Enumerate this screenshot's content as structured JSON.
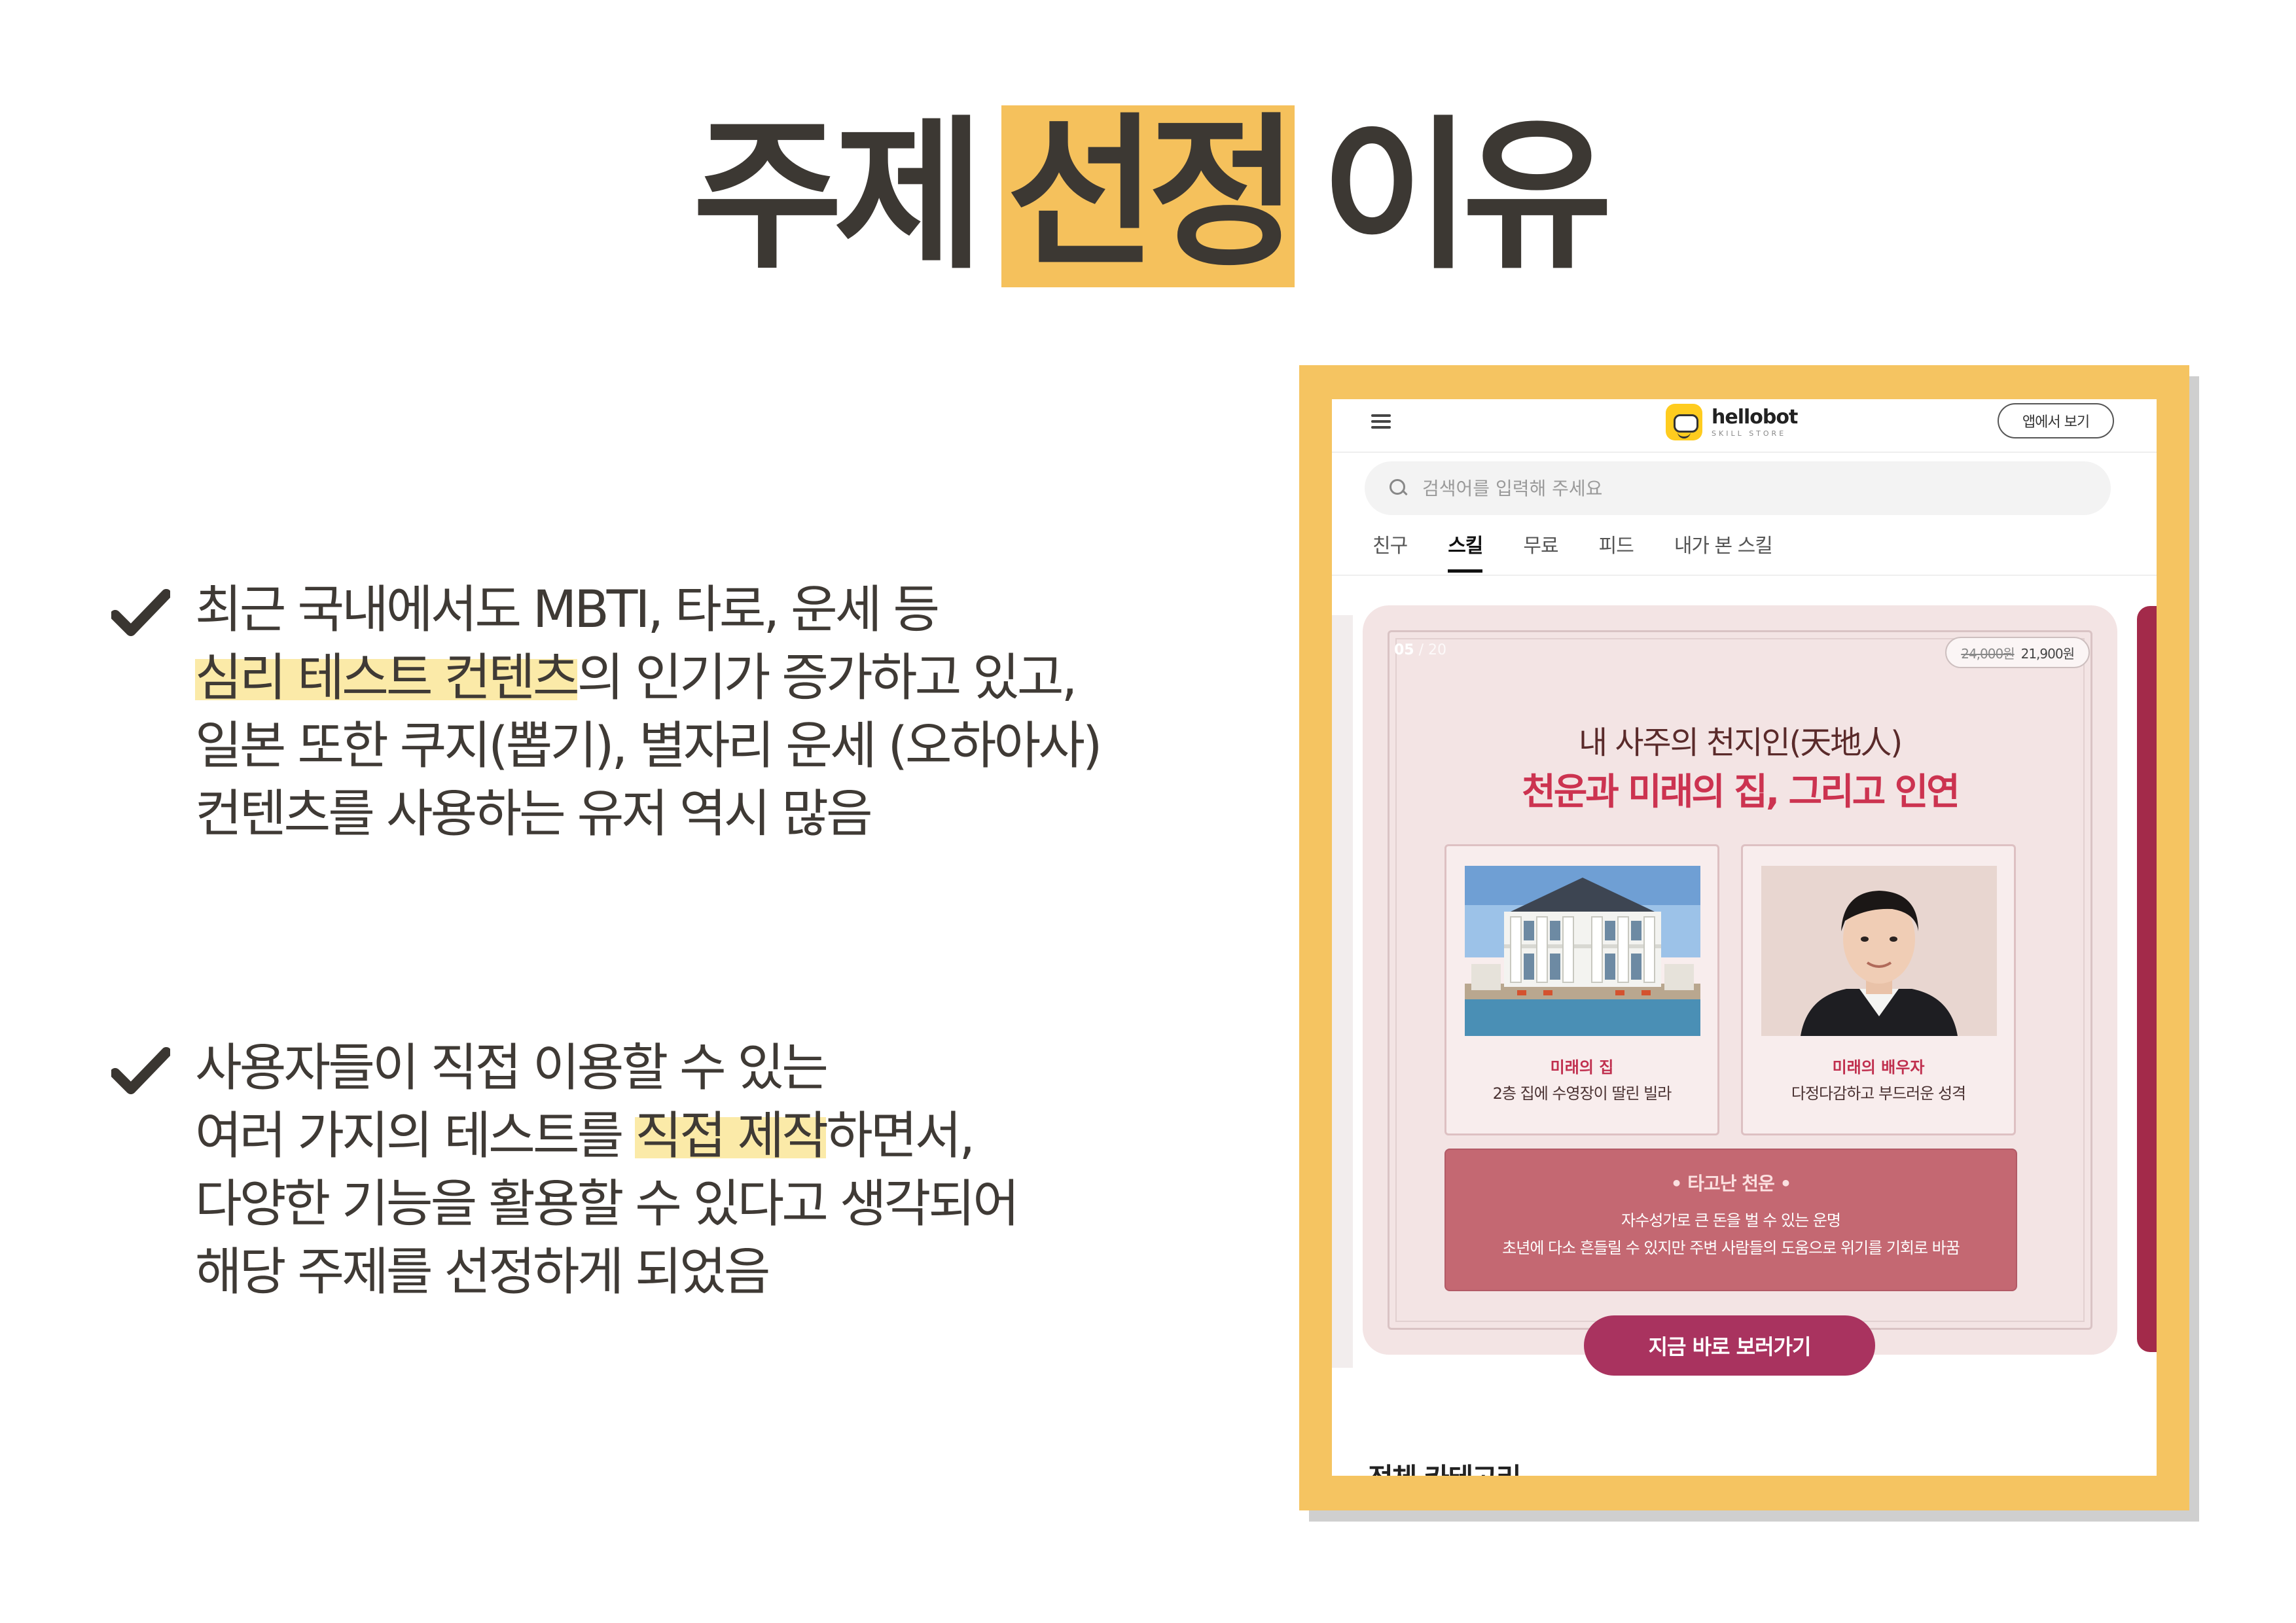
{
  "slide": {
    "title_before": "주제",
    "title_highlight": "선정",
    "title_after": "이유"
  },
  "bullets": [
    {
      "line1": "최근 국내에서도 MBTI, 타로, 운세 등",
      "line2_highlight": "심리 테스트 컨텐츠",
      "line2_rest": "의 인기가 증가하고 있고,",
      "line3": "일본 또한 쿠지(뽑기), 별자리 운세 (오하아사)",
      "line4": "컨텐츠를 사용하는 유저 역시 많음"
    },
    {
      "line1": "사용자들이 직접 이용할 수 있는",
      "line2_before": "여러 가지의 테스트를 ",
      "line2_highlight": "직접 제작",
      "line2_after": "하면서,",
      "line3": "다양한 기능을 활용할 수 있다고 생각되어",
      "line4": "해당 주제를 선정하게 되었음"
    }
  ],
  "screenshot": {
    "logo_name": "hellobot",
    "logo_sub": "SKILL STORE",
    "app_button": "앱에서 보기",
    "search_placeholder": "검색어를 입력해 주세요",
    "tabs": [
      "친구",
      "스킬",
      "무료",
      "피드",
      "내가 본 스킬"
    ],
    "active_tab": "스킬",
    "banner": {
      "counter_current": "05",
      "counter_total": " / 20",
      "price_original": "24,000원",
      "price_sale": "21,900원",
      "heading1": "내 사주의 천지인(天地人)",
      "heading2": "천운과 미래의 집, 그리고 인연",
      "card1_title": "미래의 집",
      "card1_desc": "2층 집에 수영장이 딸린 빌라",
      "card2_title": "미래의 배우자",
      "card2_desc": "다정다감하고 부드러운 성격",
      "fortune_title": "• 타고난 천운 •",
      "fortune_line1": "자수성가로 큰 돈을 벌 수 있는 운명",
      "fortune_line2": "초년에 다소 흔들릴 수 있지만 주변 사람들의 도움으로 위기를 기회로 바꿈",
      "cta": "지금 바로 보러가기"
    },
    "section_title_cut": "전체 카테고리"
  },
  "colors": {
    "accent_yellow": "#f5c15c",
    "highlight": "#fbeaa8",
    "text_dark": "#3c3833",
    "banner_red": "#cc3350",
    "cta": "#a9335f"
  }
}
